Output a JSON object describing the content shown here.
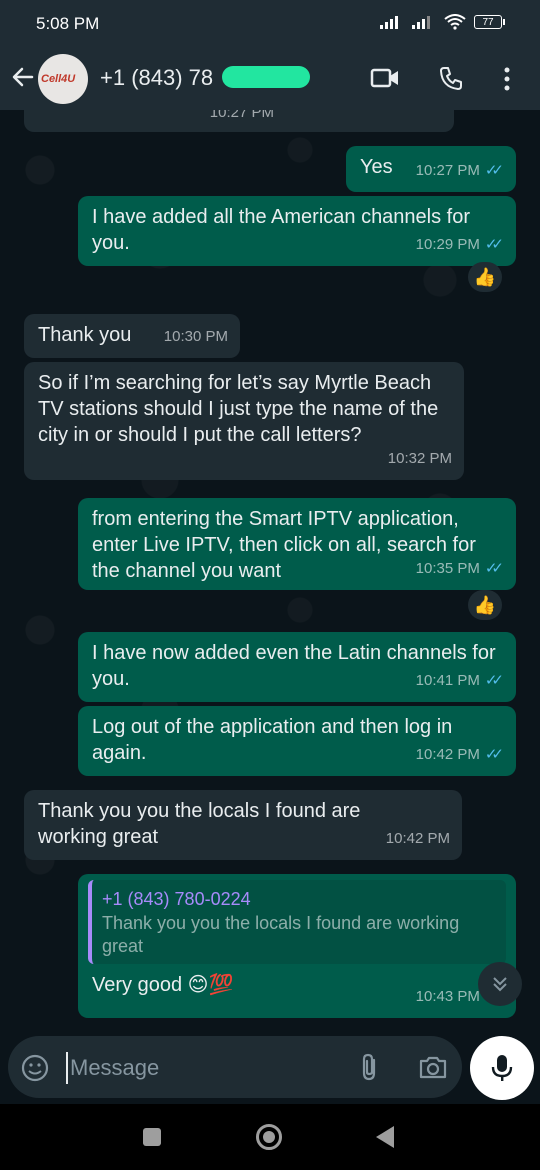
{
  "status_bar": {
    "time": "5:08 PM",
    "battery": "77"
  },
  "header": {
    "contact_name": "+1 (843) 78",
    "avatar_text": "Cell4U"
  },
  "chat": {
    "partial_time": "10:27 PM",
    "messages": [
      {
        "dir": "out",
        "text": "Yes",
        "time": "10:27 PM",
        "read": true
      },
      {
        "dir": "out",
        "text": "I have added all the American channels for you.",
        "time": "10:29 PM",
        "read": true,
        "reaction": "👍"
      },
      {
        "dir": "in",
        "text": "Thank you",
        "time": "10:30 PM"
      },
      {
        "dir": "in",
        "text": "So if I’m searching for let’s say Myrtle Beach TV stations should I just type the name of the city in or should I put the call letters?",
        "time": "10:32 PM"
      },
      {
        "dir": "out",
        "text": "from entering the Smart IPTV application, enter Live IPTV, then click on all, search for the channel you want",
        "time": "10:35 PM",
        "read": true,
        "reaction": "👍"
      },
      {
        "dir": "out",
        "text": "I have now added even the Latin channels for you.",
        "time": "10:41 PM",
        "read": true
      },
      {
        "dir": "out",
        "text": "Log out of the application and then log in again.",
        "time": "10:42 PM",
        "read": true
      },
      {
        "dir": "in",
        "text": "Thank you you the locals I found are working great",
        "time": "10:42 PM"
      },
      {
        "dir": "out",
        "quote_name": "+1 (843) 780-0224",
        "quote_text": "Thank you you the locals I found are working great",
        "text": "Very good 😊💯",
        "time": "10:43 PM",
        "read": true
      }
    ]
  },
  "input": {
    "placeholder": "Message"
  },
  "colors": {
    "incoming": "#1f2c33",
    "outgoing": "#005c4b",
    "tick": "#53bdeb",
    "background": "#0b141a"
  }
}
